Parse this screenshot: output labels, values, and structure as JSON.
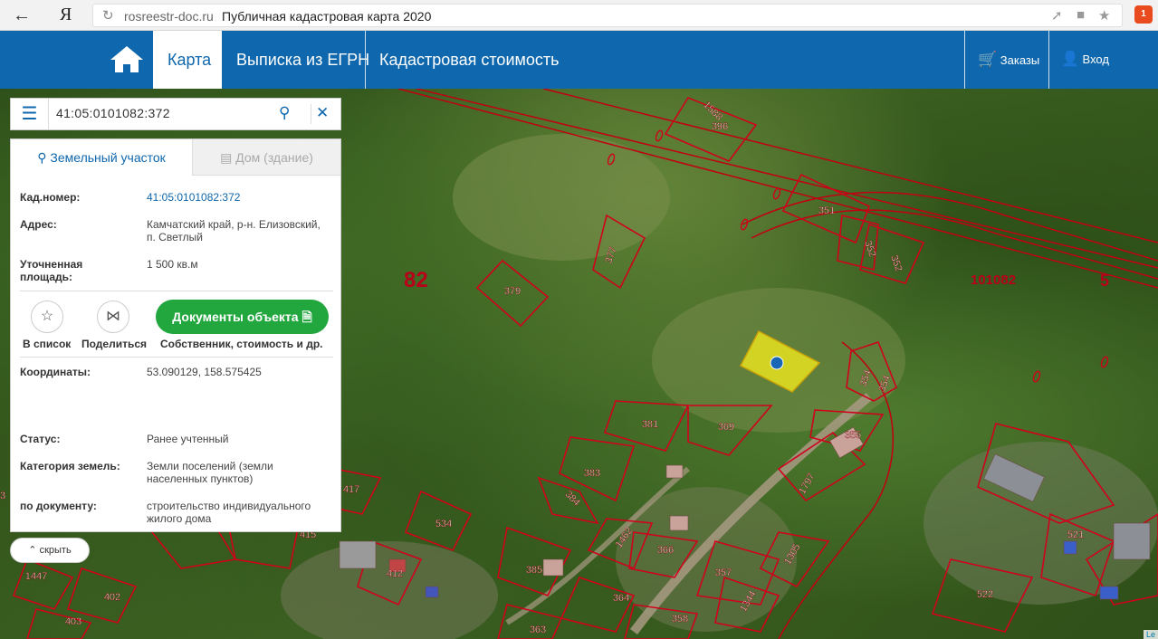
{
  "browser": {
    "back_icon": "arrow-left-icon",
    "yandex": "Я",
    "domain": "rosreestr-doc.ru",
    "title": "Публичная кадастровая карта 2020",
    "ext_badge": "1"
  },
  "nav": {
    "map": "Карта",
    "egrn": "Выписка из ЕГРН",
    "cadastral_value": "Кадастровая стоимость",
    "orders": "Заказы",
    "login": "Вход"
  },
  "search": {
    "value": "41:05:0101082:372"
  },
  "panel": {
    "tab_land": "Земельный участок",
    "tab_house": "Дом (здание)",
    "cad_key": "Кад.номер:",
    "cad_val": "41:05:0101082:372",
    "addr_key": "Адрес:",
    "addr_val": "Камчатский край, р-н. Елизовский, п. Светлый",
    "area_key": "Уточненная площадь:",
    "area_val": "1 500 кв.м",
    "fav_label": "В список",
    "share_label": "Поделиться",
    "docs_btn": "Документы объекта",
    "docs_sub": "Собственник, стоимость и др.",
    "coords_key": "Координаты:",
    "coords_val": "53.090129, 158.575425",
    "status_key": "Статус:",
    "status_val": "Ранее учтенный",
    "category_key": "Категория земель:",
    "category_val": "Земли поселений (земли населенных пунктов)",
    "doc_key": "по документу:",
    "doc_val": "строительство индивидуального жилого дома"
  },
  "hide": "скрыть",
  "map": {
    "labels": [
      "1588",
      "396",
      "351",
      "352",
      "352",
      "377",
      "379",
      "381",
      "369",
      "354",
      "354",
      "355",
      "383",
      "384",
      "1797",
      "417",
      "534",
      "415",
      "412",
      "385",
      "1462",
      "366",
      "357",
      "1305",
      "1344",
      "364",
      "358",
      "363",
      "402",
      "403",
      "1447",
      "521",
      "522",
      "3"
    ],
    "quarter_82": "82",
    "quarter_101082": "101082",
    "quarter_5": "5",
    "attribution": "Le"
  },
  "colors": {
    "nav_blue": "#0f67ad",
    "docs_green": "#22a63e",
    "parcel_red": "#d0021b",
    "selected_parcel": "#e6e21f"
  }
}
